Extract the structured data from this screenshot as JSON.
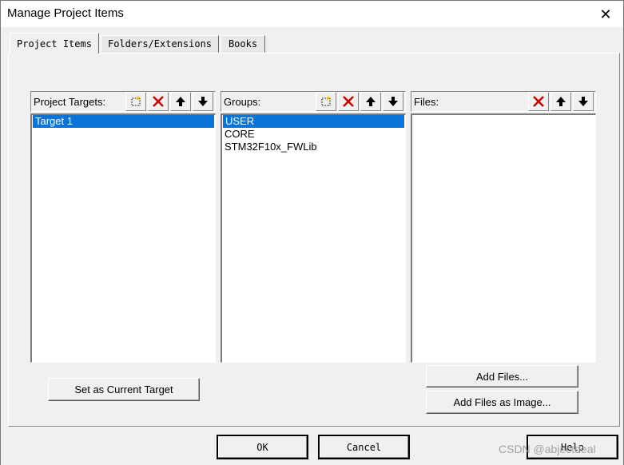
{
  "window": {
    "title": "Manage Project Items",
    "close_glyph": "✕"
  },
  "tabs": [
    {
      "label": "Project Items",
      "active": true
    },
    {
      "label": "Folders/Extensions",
      "active": false
    },
    {
      "label": "Books",
      "active": false
    }
  ],
  "columns": {
    "targets": {
      "label": "Project Targets:",
      "tools": [
        "new-icon",
        "delete-icon",
        "move-up-icon",
        "move-down-icon"
      ],
      "items": [
        {
          "label": "Target 1",
          "selected": true
        }
      ]
    },
    "groups": {
      "label": "Groups:",
      "tools": [
        "new-icon",
        "delete-icon",
        "move-up-icon",
        "move-down-icon"
      ],
      "items": [
        {
          "label": "USER",
          "selected": true
        },
        {
          "label": "CORE",
          "selected": false
        },
        {
          "label": "STM32F10x_FWLib",
          "selected": false
        }
      ]
    },
    "files": {
      "label": "Files:",
      "tools": [
        "delete-icon",
        "move-up-icon",
        "move-down-icon"
      ],
      "items": []
    }
  },
  "buttons": {
    "set_current_target": "Set as Current Target",
    "add_files": "Add Files...",
    "add_files_image": "Add Files as Image...",
    "ok": "OK",
    "cancel": "Cancel",
    "help": "Help"
  },
  "watermark": "CSDN @abjectdeal",
  "colors": {
    "selection": "#0a74d9",
    "delete_red": "#cc0000"
  }
}
